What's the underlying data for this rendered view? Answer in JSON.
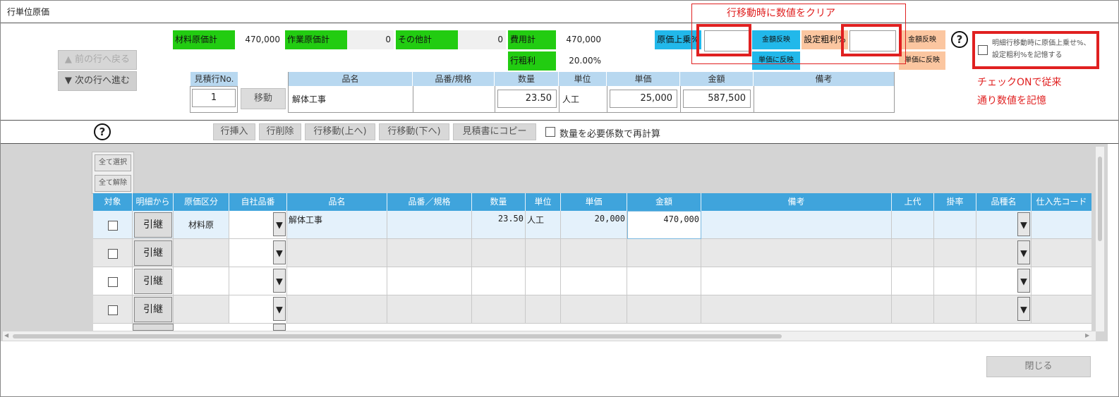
{
  "window": {
    "title": "行単位原価"
  },
  "nav": {
    "prev_label": "▲ 前の行へ戻る",
    "next_label": "▼ 次の行へ進む"
  },
  "summary": {
    "material_label": "材料原価計",
    "material_value": "470,000",
    "labor_label": "作業原価計",
    "labor_value": "0",
    "other_label": "その他計",
    "other_value": "0",
    "expense_label": "費用計",
    "expense_value": "470,000",
    "row_margin_label": "行粗利",
    "row_margin_value": "20.00%"
  },
  "controls": {
    "cost_multiplier_label": "原価上乗%",
    "amount_reflect_label": "金額反映",
    "unit_price_reflect_label": "単価に反映",
    "target_margin_label": "設定粗利%",
    "amount_reflect2_label": "金額反映",
    "unit_price_reflect2_label": "単価に反映",
    "remember_label": "明細行移動時に原価上乗せ%、設定粗利%を記憶する"
  },
  "annotations": {
    "clear_note": "行移動時に数値をクリア",
    "check_note_line1": "チェックONで従来",
    "check_note_line2": "通り数値を記憶"
  },
  "estimate": {
    "row_no_label": "見積行No.",
    "row_no_value": "1",
    "move_label": "移動",
    "headers": [
      "品名",
      "品番/規格",
      "数量",
      "単位",
      "単価",
      "金額",
      "備考"
    ],
    "item_name": "解体工事",
    "item_code": "",
    "quantity": "23.50",
    "unit": "人工",
    "unit_price": "25,000",
    "amount": "587,500",
    "note": ""
  },
  "toolbar": {
    "insert_label": "行挿入",
    "delete_label": "行削除",
    "move_up_label": "行移動(上へ)",
    "move_down_label": "行移動(下へ)",
    "copy_label": "見積書にコピー",
    "recalc_label": "数量を必要係数で再計算"
  },
  "grid": {
    "select_all_label": "全て選択",
    "deselect_all_label": "全て解除",
    "columns": [
      "対象",
      "明細から",
      "原価区分",
      "自社品番",
      "品名",
      "品番／規格",
      "数量",
      "単位",
      "単価",
      "金額",
      "備考",
      "上代",
      "掛率",
      "品種名",
      "仕入先コード"
    ],
    "inherit_label": "引継",
    "rows": [
      {
        "category": "材料原",
        "name": "解体工事",
        "qty": "23.50",
        "unit": "人工",
        "price": "20,000",
        "amount": "470,000"
      },
      {
        "category": "",
        "name": "",
        "qty": "",
        "unit": "",
        "price": "",
        "amount": ""
      },
      {
        "category": "",
        "name": "",
        "qty": "",
        "unit": "",
        "price": "",
        "amount": ""
      },
      {
        "category": "",
        "name": "",
        "qty": "",
        "unit": "",
        "price": "",
        "amount": ""
      }
    ]
  },
  "footer": {
    "close_label": "閉じる"
  },
  "icons": {
    "help": "question-circle-icon",
    "dropdown": "triangle-down-icon"
  }
}
